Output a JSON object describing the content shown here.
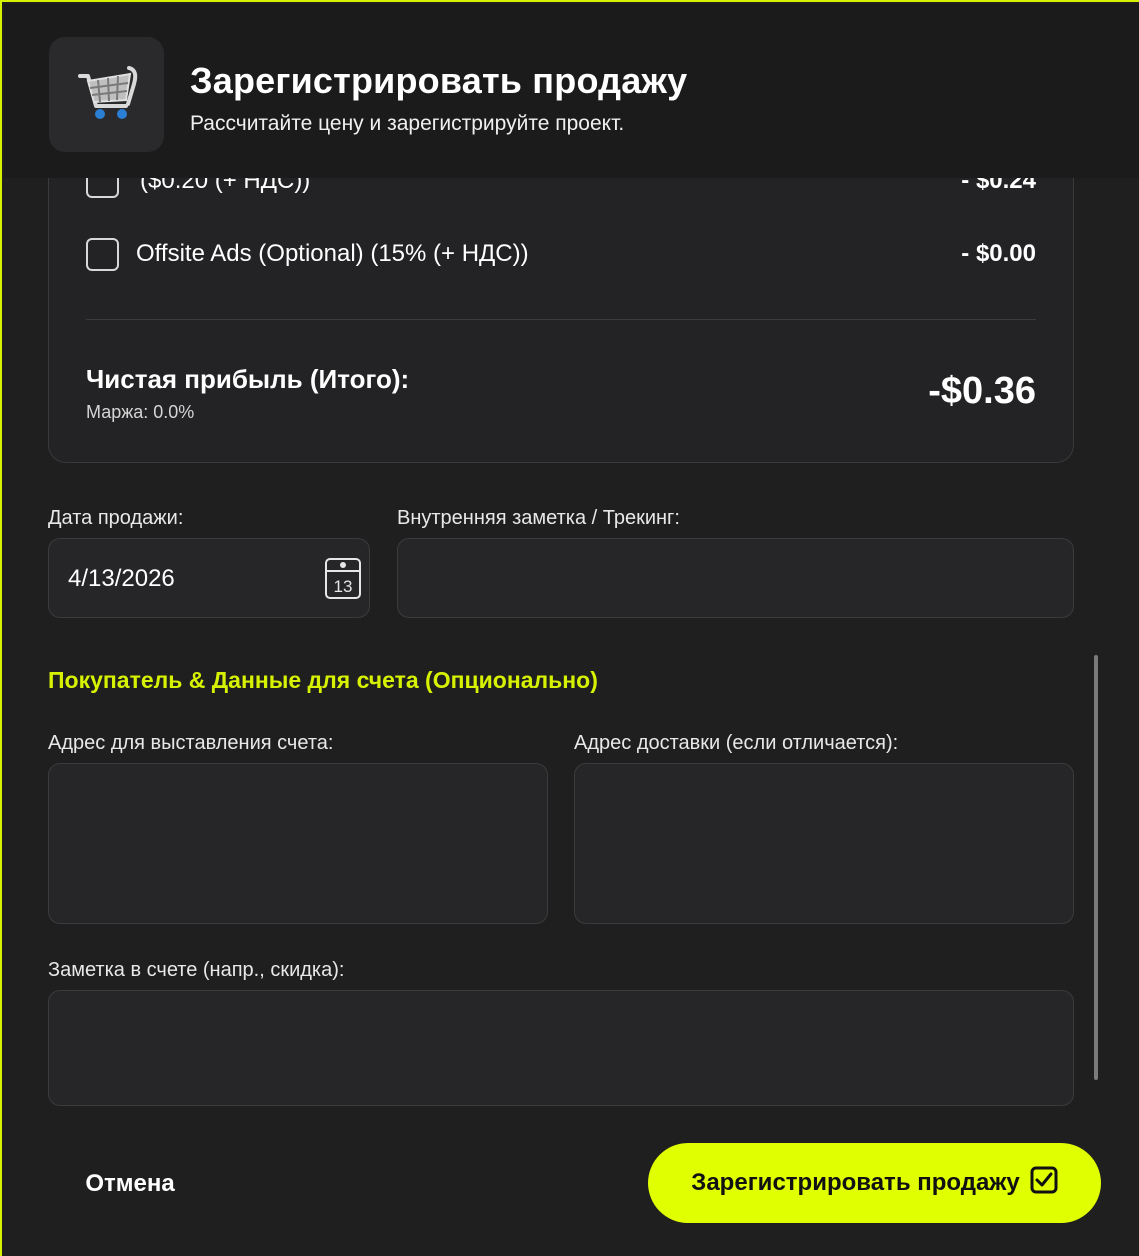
{
  "header": {
    "title": "Зарегистрировать продажу",
    "subtitle": "Рассчитайте цену и зарегистрируйте проект.",
    "icon": "shopping-cart-icon"
  },
  "summary": {
    "fees": [
      {
        "label": "($0.20 (+ НДС))",
        "amount": "- $0.24",
        "checked": false
      },
      {
        "label": "Offsite Ads (Optional) (15% (+ НДС))",
        "amount": "- $0.00",
        "checked": false
      }
    ],
    "net_label": "Чистая прибыль (Итого):",
    "margin_label": "Маржа: 0.0%",
    "net_value": "-$0.36"
  },
  "form": {
    "sale_date_label": "Дата продажи:",
    "sale_date_value": "4/13/2026",
    "calendar_day": "13",
    "internal_note_label": "Внутренняя заметка / Трекинг:",
    "internal_note_value": "",
    "buyer_section_title": "Покупатель & Данные для счета (Опционально)",
    "billing_address_label": "Адрес для выставления счета:",
    "billing_address_value": "",
    "shipping_address_label": "Адрес доставки (если отличается):",
    "shipping_address_value": "",
    "invoice_note_label": "Заметка в счете (напр., скидка):",
    "invoice_note_value": ""
  },
  "footer": {
    "cancel_label": "Отмена",
    "submit_label": "Зарегистрировать продажу",
    "submit_icon": "checkbox-checked-icon"
  },
  "colors": {
    "accent": "#e0ff00",
    "section_title": "#d7f200",
    "background": "#1f1f20",
    "input_background": "#262628"
  }
}
